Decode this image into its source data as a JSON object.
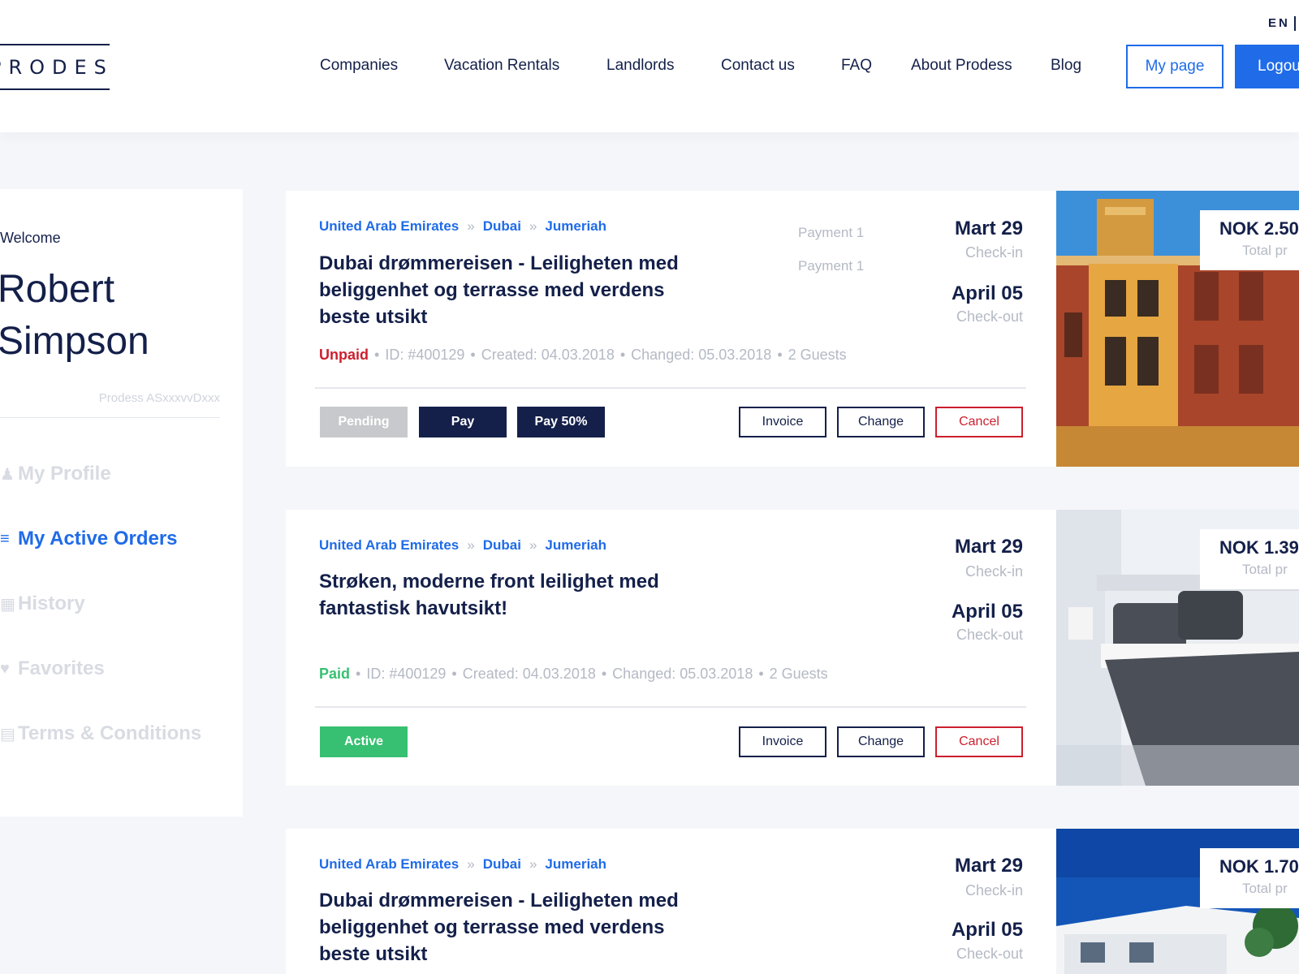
{
  "header": {
    "logo": "PRODESS",
    "language": "EN",
    "nav": [
      "Companies",
      "Vacation Rentals",
      "Landlords",
      "Contact us",
      "FAQ",
      "About Prodess",
      "Blog"
    ],
    "my_page_label": "My page",
    "logout_label": "Logout"
  },
  "sidebar": {
    "welcome": "Welcome",
    "user_name": "Robert Simpson",
    "company": "Prodess ASxxxvvDxxx",
    "items": [
      {
        "label": "My Profile",
        "icon": "user-icon",
        "active": false
      },
      {
        "label": "My Active Orders",
        "icon": "list-icon",
        "active": true
      },
      {
        "label": "History",
        "icon": "calendar-icon",
        "active": false
      },
      {
        "label": "Favorites",
        "icon": "heart-icon",
        "active": false
      },
      {
        "label": "Terms & Conditions",
        "icon": "document-icon",
        "active": false
      }
    ]
  },
  "orders": [
    {
      "breadcrumb": [
        "United Arab Emirates",
        "Dubai",
        "Jumeriah"
      ],
      "title": "Dubai drømmereisen - Leiligheten med beliggenhet og terrasse med verdens beste utsikt",
      "status": "Unpaid",
      "id": "ID: #400129",
      "created": "Created: 04.03.2018",
      "changed": "Changed: 05.03.2018",
      "guests": "2 Guests",
      "payments": [
        "Payment 1",
        "Payment 1"
      ],
      "checkin_date": "Mart 29",
      "checkin_label": "Check-in",
      "checkout_date": "April 05",
      "checkout_label": "Check-out",
      "buttons": [
        "Pending",
        "Pay",
        "Pay 50%"
      ],
      "actions": [
        "Invoice",
        "Change",
        "Cancel"
      ],
      "price": "NOK 2.50",
      "price_label": "Total pr"
    },
    {
      "breadcrumb": [
        "United Arab Emirates",
        "Dubai",
        "Jumeriah"
      ],
      "title": "Strøken, moderne front leilighet med fantastisk havutsikt!",
      "status": "Paid",
      "id": "ID: #400129",
      "created": "Created: 04.03.2018",
      "changed": "Changed: 05.03.2018",
      "guests": "2 Guests",
      "checkin_date": "Mart 29",
      "checkin_label": "Check-in",
      "checkout_date": "April 05",
      "checkout_label": "Check-out",
      "buttons": [
        "Active"
      ],
      "actions": [
        "Invoice",
        "Change",
        "Cancel"
      ],
      "price": "NOK 1.39",
      "price_label": "Total pr"
    },
    {
      "breadcrumb": [
        "United Arab Emirates",
        "Dubai",
        "Jumeriah"
      ],
      "title": "Dubai drømmereisen - Leiligheten med beliggenhet og terrasse med verdens beste utsikt",
      "checkin_date": "Mart 29",
      "checkin_label": "Check-in",
      "checkout_date": "April 05",
      "checkout_label": "Check-out",
      "price": "NOK 1.70",
      "price_label": "Total pr"
    }
  ],
  "colors": {
    "accent": "#1f6be8",
    "navy": "#14204a",
    "unpaid": "#cc1f2e",
    "paid": "#37c071",
    "background": "#f4f6f9"
  }
}
